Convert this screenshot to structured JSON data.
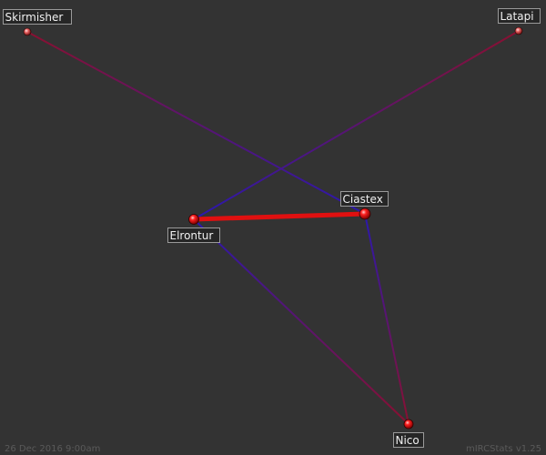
{
  "nodes": [
    {
      "id": "skirmisher",
      "label": "Skirmisher"
    },
    {
      "id": "latapi",
      "label": "Latapi"
    },
    {
      "id": "ciastex",
      "label": "Ciastex"
    },
    {
      "id": "elrontur",
      "label": "Elrontur"
    },
    {
      "id": "nico",
      "label": "Nico"
    }
  ],
  "edges": [
    {
      "from": "skirmisher",
      "to": "ciastex"
    },
    {
      "from": "latapi",
      "to": "elrontur"
    },
    {
      "from": "elrontur",
      "to": "ciastex"
    },
    {
      "from": "ciastex",
      "to": "nico"
    },
    {
      "from": "elrontur",
      "to": "nico"
    }
  ],
  "footer": {
    "timestamp": "26 Dec 2016 9:00am",
    "generator": "mIRCStats v1.25"
  },
  "colors": {
    "background": "#333333",
    "edge_strong": "#e01010",
    "edge_red": "#8a1030",
    "edge_blue": "#2a18b0"
  }
}
